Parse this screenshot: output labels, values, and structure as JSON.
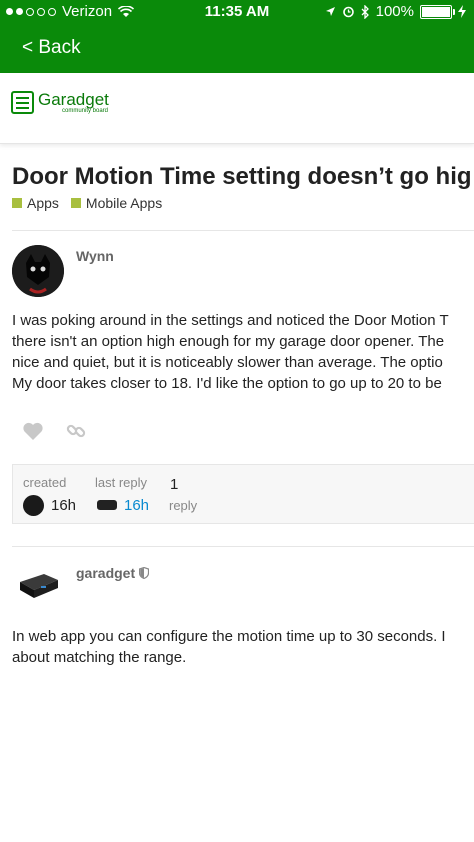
{
  "status_bar": {
    "carrier": "Verizon",
    "time": "11:35 AM",
    "battery": "100%"
  },
  "nav": {
    "back_label": "< Back"
  },
  "logo": {
    "name": "Garadget",
    "sub": "community board"
  },
  "topic": {
    "title": "Door Motion Time setting doesn’t go hig",
    "categories": [
      "Apps",
      "Mobile Apps"
    ]
  },
  "posts": [
    {
      "username": "Wynn",
      "lines": [
        "I was poking around in the settings and noticed the Door Motion T",
        "there isn't an option high enough for my garage door opener. The",
        "nice and quiet, but it is noticeably slower than average. The optio",
        "My door takes closer to 18. I'd like the option to go up to 20 to be"
      ]
    },
    {
      "username": "garadget",
      "lines": [
        "In web app you can configure the motion time up to 30 seconds. I",
        "about matching the range."
      ]
    }
  ],
  "stats": {
    "created_label": "created",
    "created_value": "16h",
    "last_reply_label": "last reply",
    "last_reply_value": "16h",
    "reply_count": "1",
    "reply_label": "reply"
  },
  "icons": {
    "like": "heart-icon",
    "share": "link-icon",
    "moderator": "shield-icon"
  },
  "colors": {
    "brand_green": "#0a8a0a",
    "category": "#a8bf3f",
    "link_blue": "#0a8ad0"
  }
}
